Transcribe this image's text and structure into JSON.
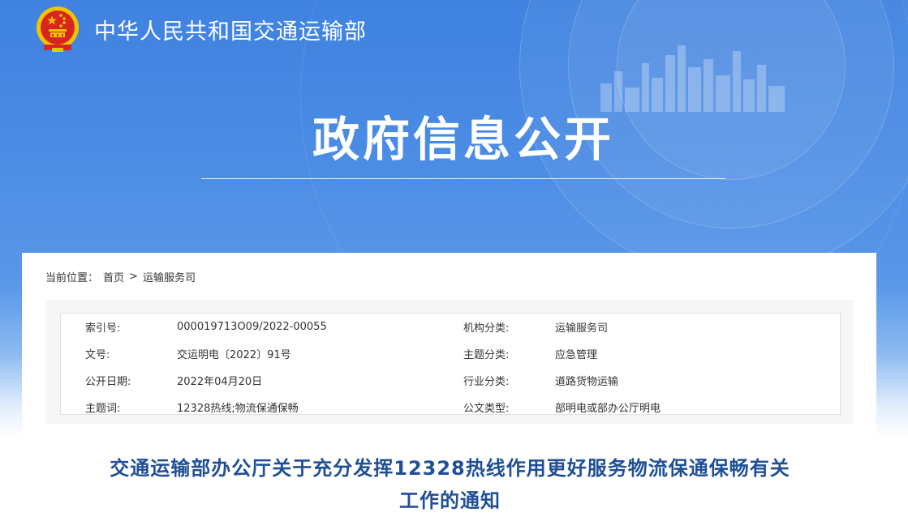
{
  "site": {
    "name": "中华人民共和国交通运输部"
  },
  "section": {
    "title": "政府信息公开"
  },
  "breadcrumb": {
    "label": "当前位置：",
    "items": [
      "首页",
      "运输服务司"
    ],
    "separator": ">"
  },
  "meta": {
    "rows": [
      {
        "k1": "索引号:",
        "v1": "000019713O09/2022-00055",
        "k2": "机构分类:",
        "v2": "运输服务司"
      },
      {
        "k1": "文号:",
        "v1": "交运明电〔2022〕91号",
        "k2": "主题分类:",
        "v2": "应急管理"
      },
      {
        "k1": "公开日期:",
        "v1": "2022年04月20日",
        "k2": "行业分类:",
        "v2": "道路货物运输"
      },
      {
        "k1": "主题词:",
        "v1": "12328热线;物流保通保畅",
        "k2": "公文类型:",
        "v2": "部明电或部办公厅明电"
      }
    ]
  },
  "document": {
    "title_line1": "交通运输部办公厅关于充分发挥12328热线作用更好服务物流保通保畅有关",
    "title_line2": "工作的通知"
  },
  "colors": {
    "hero_blue": "#3f82e0",
    "title_blue": "#1f4f96",
    "emblem_red": "#d7261f",
    "emblem_gold": "#f3c300"
  },
  "icons": {
    "emblem": "national-emblem-icon",
    "skyline": "city-skyline-icon"
  }
}
